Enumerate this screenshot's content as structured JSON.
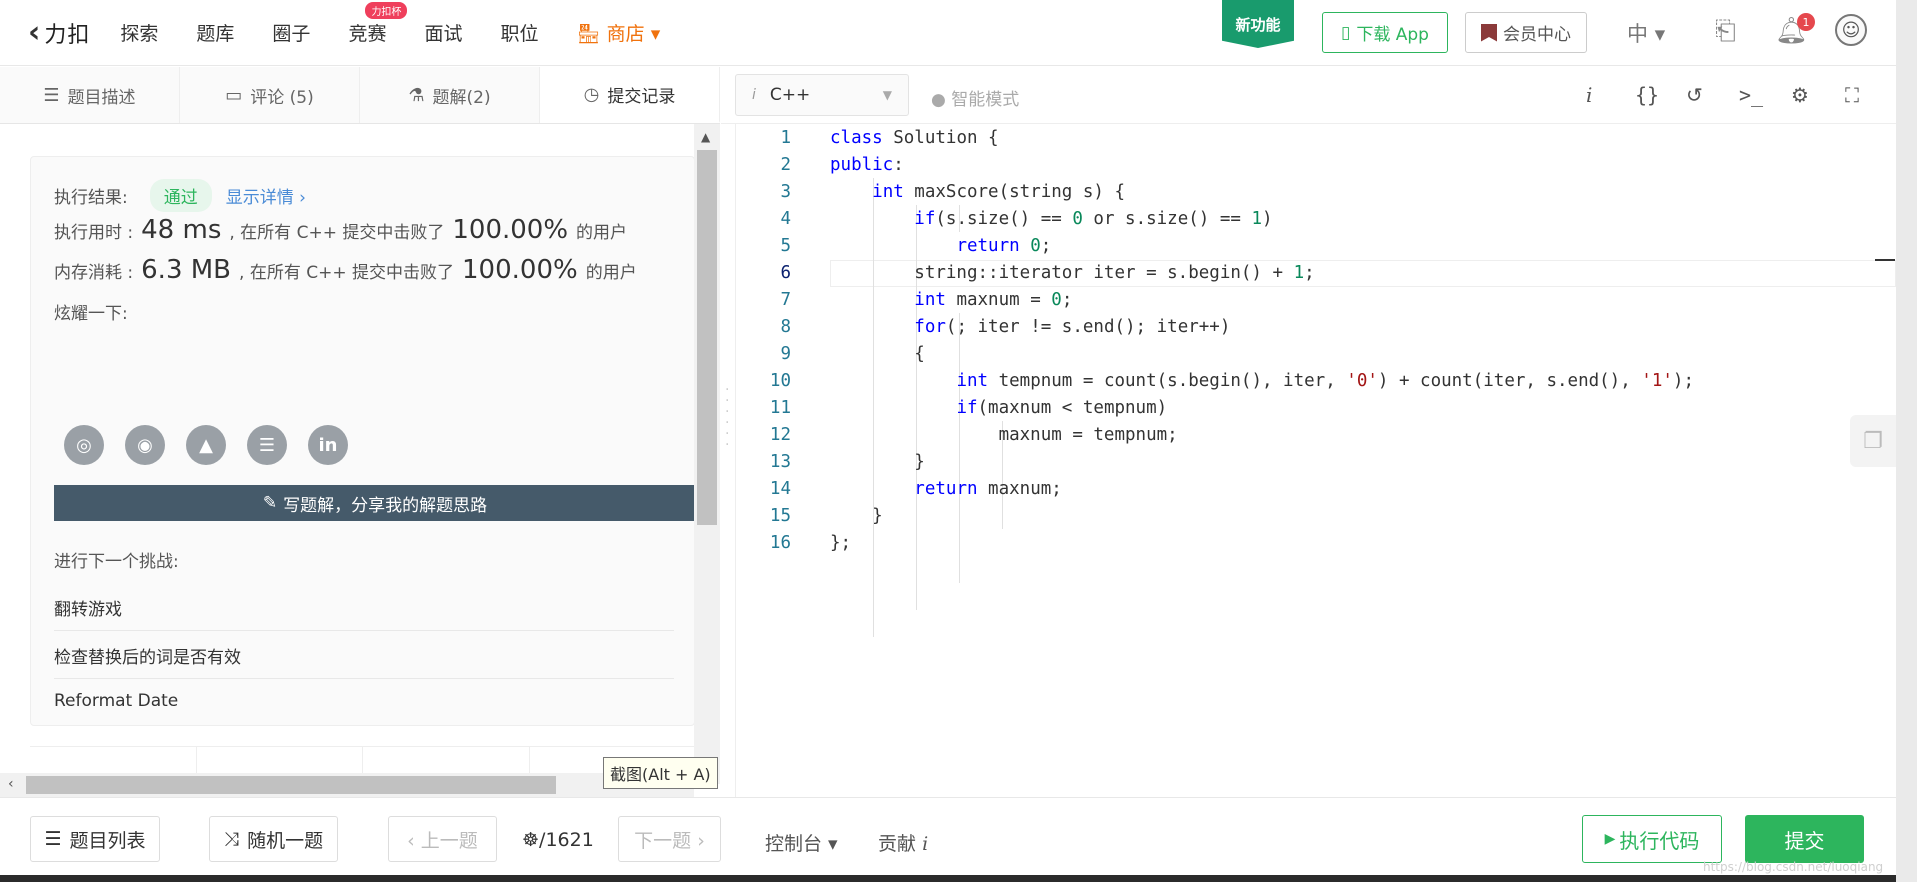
{
  "topbar": {
    "logo_mark": "←",
    "logo_text": "力扣",
    "nav": [
      {
        "label": "探索"
      },
      {
        "label": "题库"
      },
      {
        "label": "圈子"
      },
      {
        "label": "竞赛",
        "badge": "力扣杯"
      },
      {
        "label": "面试"
      },
      {
        "label": "职位"
      },
      {
        "label": "商店 ▾"
      }
    ],
    "new_feature": "新功能",
    "download_app": "下载 App",
    "vip_center": "会员中心",
    "lang": "中 ▾",
    "notif_count": "1",
    "avatar_glyph": "☺"
  },
  "left_tabs": [
    {
      "icon": "☰",
      "label": "题目描述"
    },
    {
      "icon": "▭",
      "label": "评论 (5)"
    },
    {
      "icon": "⚗",
      "label": "题解(2)"
    },
    {
      "icon": "◷",
      "label": "提交记录"
    }
  ],
  "result": {
    "label": "执行结果:",
    "status": "通过",
    "detail": "显示详情 ›",
    "time_label": "执行用时 :",
    "time_value": "48 ms",
    "time_mid": ", 在所有 C++ 提交中击败了",
    "time_pct": "100.00%",
    "time_tail": "的用户",
    "mem_label": "内存消耗 :",
    "mem_value": "6.3 MB",
    "mem_mid": ", 在所有 C++ 提交中击败了",
    "mem_pct": "100.00%",
    "mem_tail": "的用户",
    "share_label": "炫耀一下:",
    "write_btn": "写题解，分享我的解题思路",
    "next_label": "进行下一个挑战:",
    "next_items": [
      "翻转游戏",
      "检查替换后的词是否有效",
      "Reformat Date"
    ]
  },
  "tooltip": "截图(Alt + A)",
  "editor": {
    "lang": "C++",
    "smart_mode": "智能模式",
    "lines": [
      "class Solution {",
      "public:",
      "    int maxScore(string s) {",
      "        if(s.size() == 0 or s.size() == 1)",
      "            return 0;",
      "        string::iterator iter = s.begin() + 1;",
      "        int maxnum = 0;",
      "        for(; iter != s.end(); iter++)",
      "        {",
      "            int tempnum = count(s.begin(), iter, '0') + count(iter, s.end(), '1');",
      "            if(maxnum < tempnum)",
      "                maxnum = tempnum;",
      "        }",
      "        return maxnum;",
      "    }",
      "};"
    ],
    "line_numbers": [
      "1",
      "2",
      "3",
      "4",
      "5",
      "6",
      "7",
      "8",
      "9",
      "10",
      "11",
      "12",
      "13",
      "14",
      "15",
      "16"
    ]
  },
  "bottom": {
    "problem_list": "题目列表",
    "random": "随机一题",
    "prev": "‹ 上一题",
    "page": "/1621",
    "next": "下一题 ›",
    "console": "控制台 ▾",
    "contribute": "贡献",
    "run": "执行代码",
    "submit": "提交"
  },
  "watermark": "https://blog.csdn.net/luoqiang"
}
